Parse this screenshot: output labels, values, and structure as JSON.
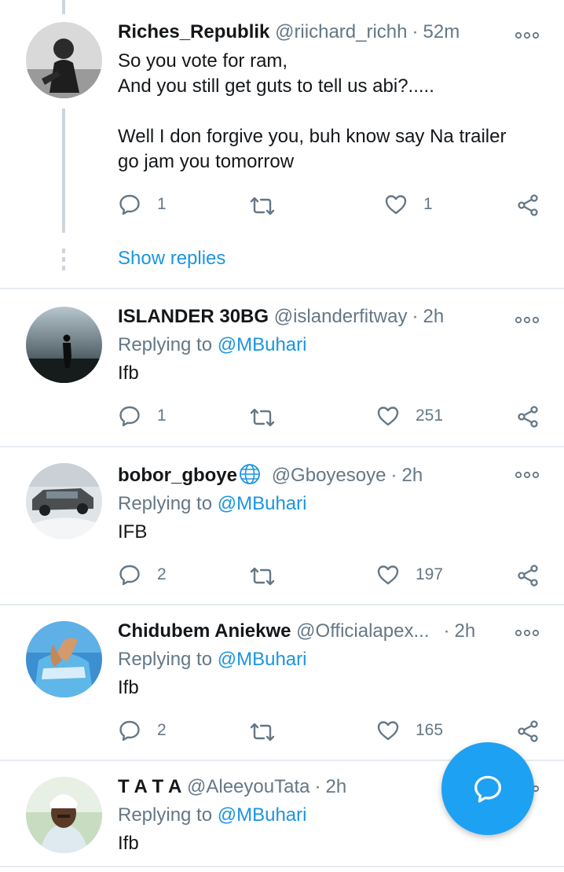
{
  "icons": {
    "reply": "speech-bubble-icon",
    "retweet": "retweet-icon",
    "like": "heart-icon",
    "share": "share-icon",
    "more": "more-options-icon",
    "globe": "globe-icon",
    "compose_reply": "compose-reply-icon"
  },
  "colors": {
    "accent": "#1da1f2",
    "link": "#1b95e0",
    "muted": "#657786"
  },
  "tweets": [
    {
      "name": "Riches_Republik",
      "handle": "@riichard_richh",
      "sep": "·",
      "time": "52m",
      "body": "So you vote for ram,\nAnd you still get guts to tell us abi?.....\n\nWell I don forgive you, buh know say Na trailer\ngo jam you tomorrow",
      "replies": "1",
      "likes": "1",
      "show_replies": "Show replies"
    },
    {
      "name": "ISLANDER 30BG",
      "handle": "@islanderfitway",
      "sep": "·",
      "time": "2h",
      "replying_prefix": "Replying to",
      "replying_to": "@MBuhari",
      "body": "Ifb",
      "replies": "1",
      "likes": "251"
    },
    {
      "name": "bobor_gboye",
      "handle": "@Gboyesoye",
      "sep": "·",
      "time": "2h",
      "replying_prefix": "Replying to",
      "replying_to": "@MBuhari",
      "body": "IFB",
      "replies": "2",
      "likes": "197"
    },
    {
      "name": "Chidubem Aniekwe",
      "handle": "@Officialapex...",
      "sep": "·",
      "time": "2h",
      "replying_prefix": "Replying to",
      "replying_to": "@MBuhari",
      "body": "Ifb",
      "replies": "2",
      "likes": "165"
    },
    {
      "name": "T A T A",
      "handle": "@AleeyouTata",
      "sep": "·",
      "time": "2h",
      "replying_prefix": "Replying to",
      "replying_to": "@MBuhari",
      "body": "Ifb"
    }
  ]
}
